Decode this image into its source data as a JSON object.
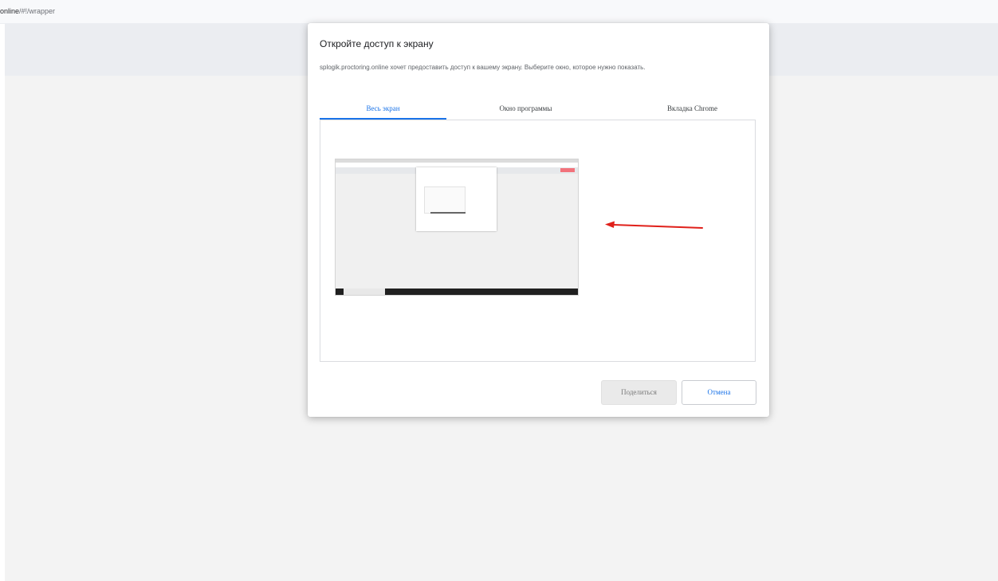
{
  "browser": {
    "url_host_tail": "online",
    "url_path": "/#!/wrapper"
  },
  "dialog": {
    "title": "Откройте доступ к экрану",
    "description": "splogik.proctoring.online хочет предоставить доступ к вашему экрану. Выберите окно, которое нужно показать.",
    "tabs": [
      {
        "label": "Весь экран",
        "selected": true
      },
      {
        "label": "Окно программы",
        "selected": false
      },
      {
        "label": "Вкладка Chrome",
        "selected": false
      }
    ],
    "buttons": {
      "share_label": "Поделиться",
      "cancel_label": "Отмена"
    }
  },
  "colors": {
    "accent": "#1a73e8",
    "annotation_arrow": "#e0201a",
    "page_background": "#f3f3f3"
  },
  "icons": {
    "annotation": "red-arrow-icon"
  }
}
